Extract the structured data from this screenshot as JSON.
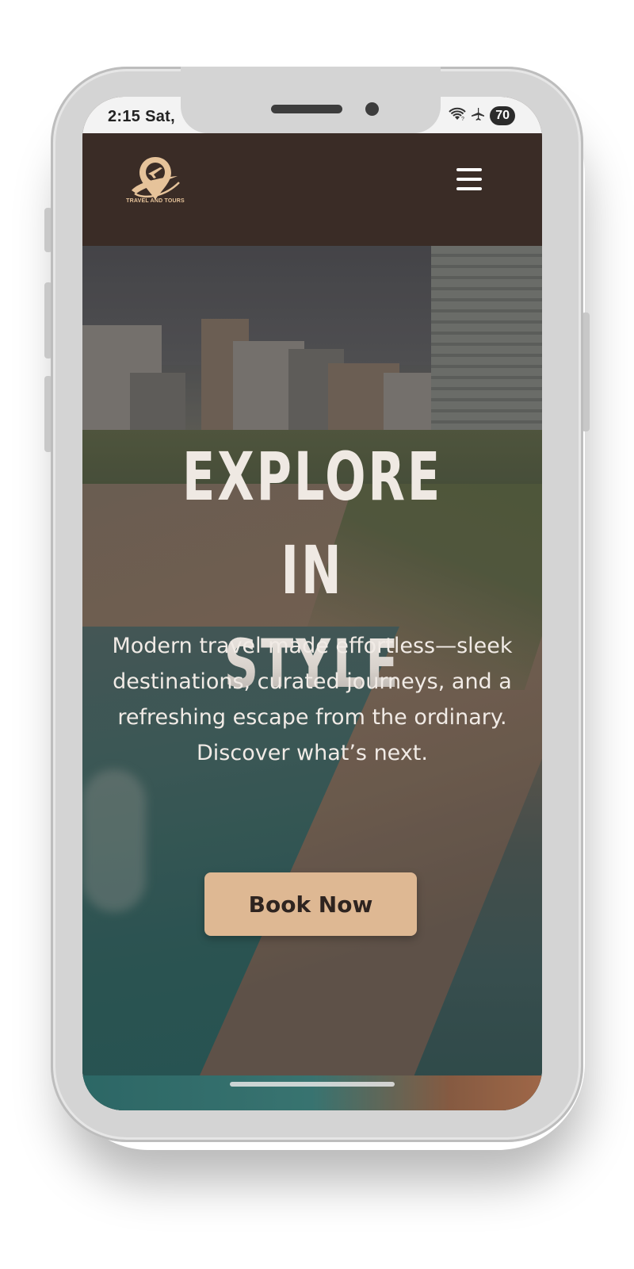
{
  "status_bar": {
    "time": "2:15 Sat,",
    "battery": "70",
    "wifi_icon": "wifi-icon",
    "airplane_icon": "airplane-icon"
  },
  "header": {
    "logo_text": "TRAVEL AND TOURS",
    "logo_icon": "location-pin-plane-icon",
    "menu_icon": "hamburger-menu-icon"
  },
  "hero": {
    "title_line1": "EXPLORE IN",
    "title_line2": "STYLE",
    "subtitle": "Modern travel made effortless—sleek destinations, curated journeys, and a refreshing escape from the ordinary. Discover what’s next.",
    "cta_label": "Book Now"
  },
  "colors": {
    "header_bg": "#3a2c26",
    "accent": "#deb893",
    "logo_gold": "#e6c39a",
    "text_light": "#efe9e3"
  }
}
